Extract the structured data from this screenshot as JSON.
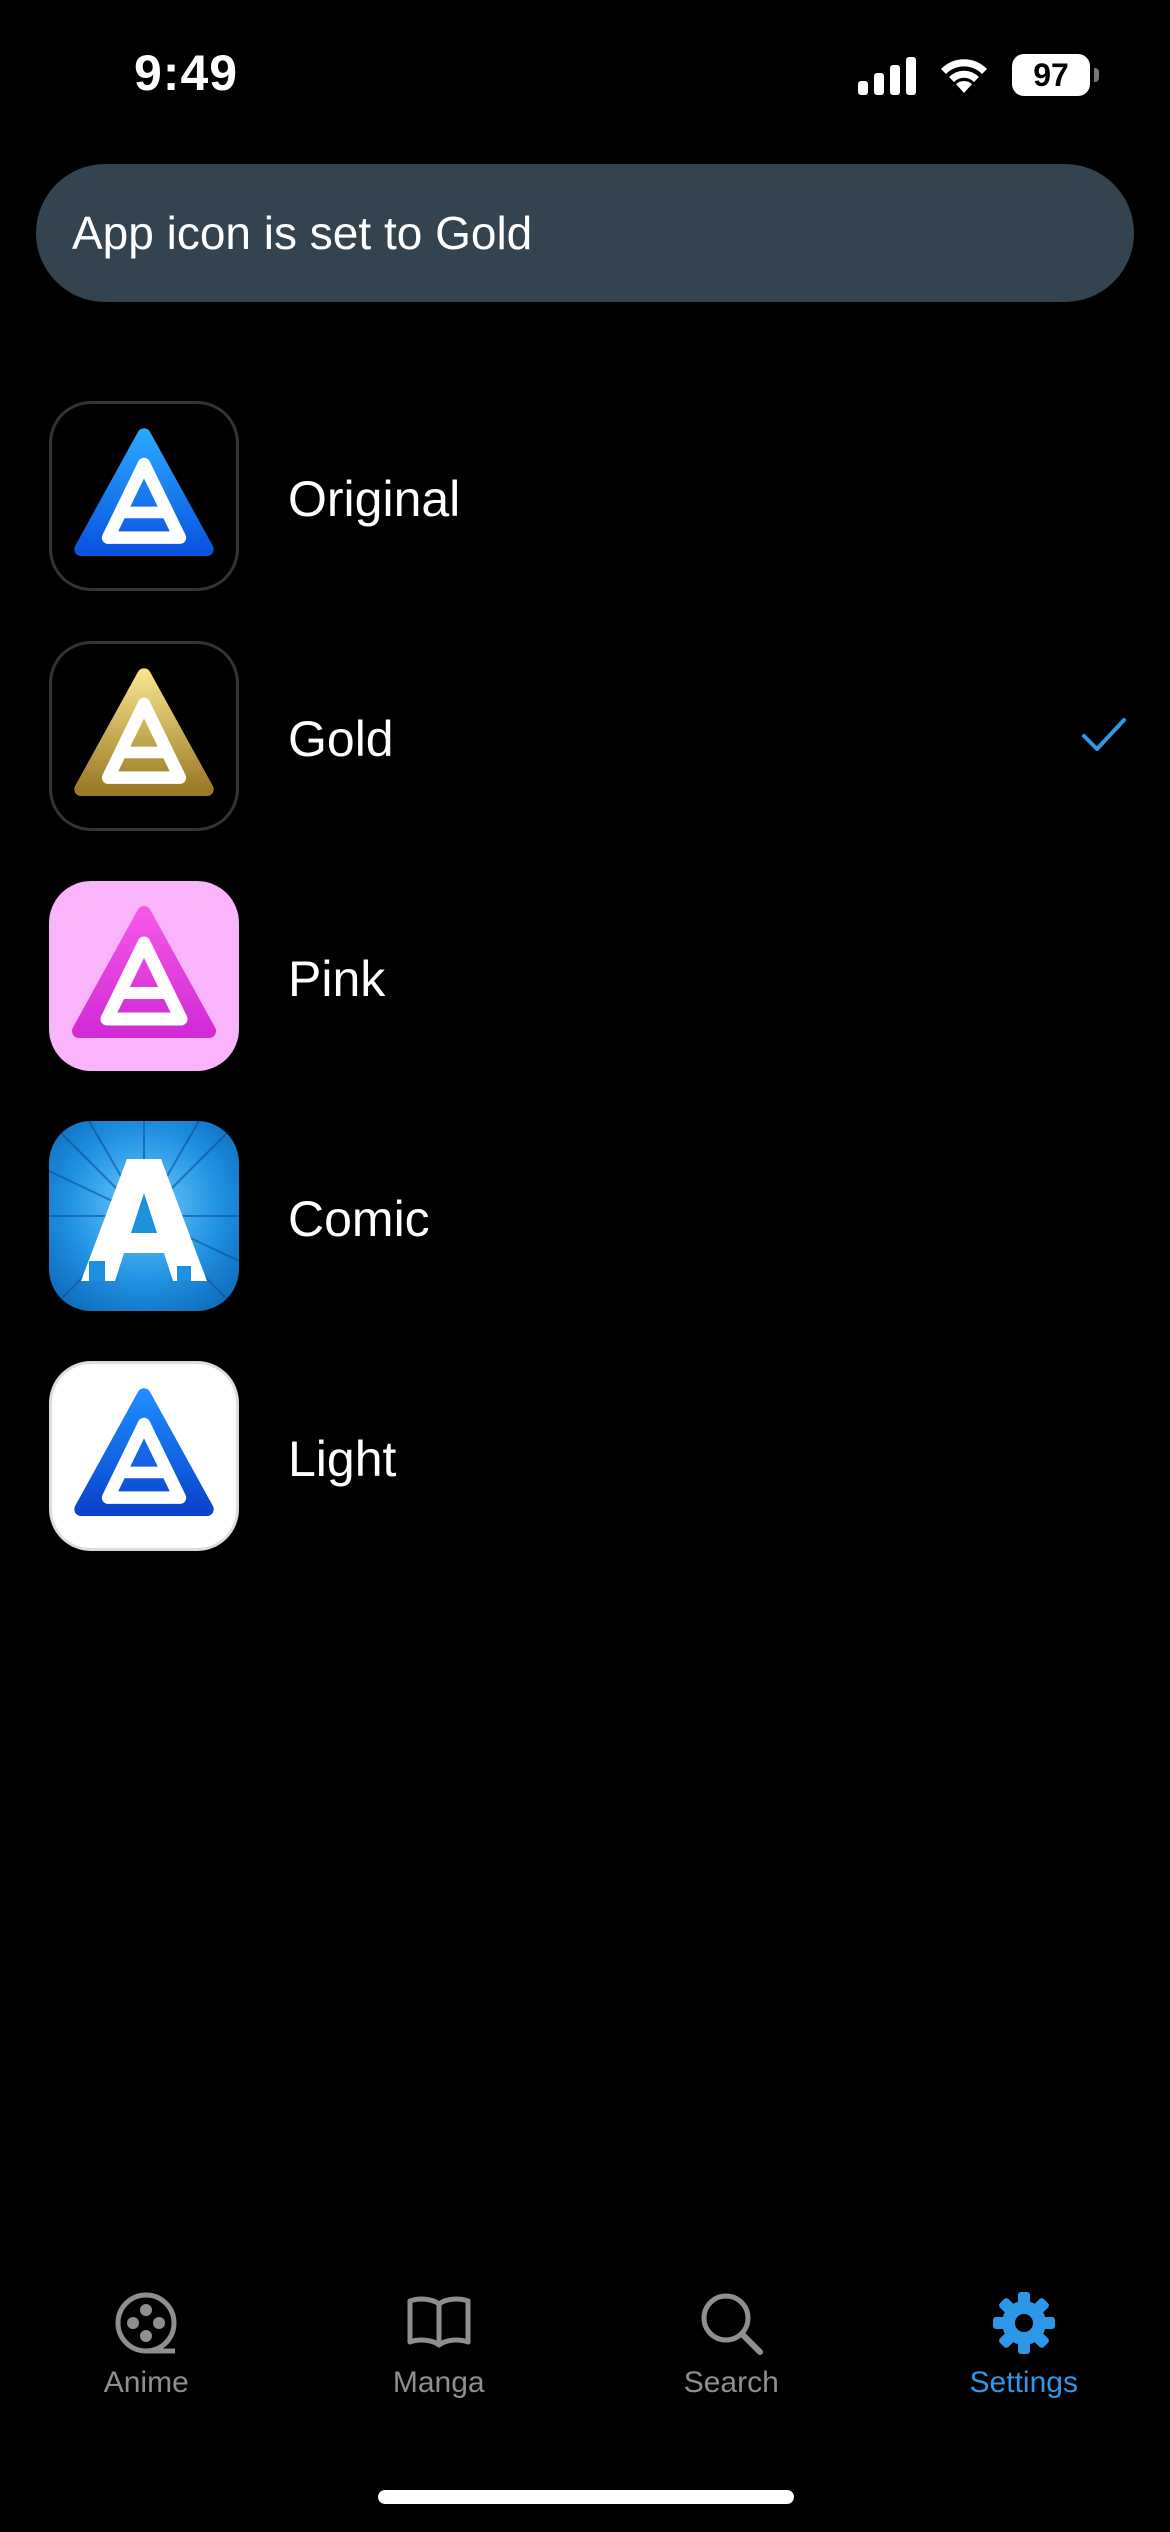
{
  "status_bar": {
    "time": "9:49",
    "battery": "97"
  },
  "toast": {
    "message": "App icon is set to Gold"
  },
  "icons": [
    {
      "label": "Original",
      "selected": false,
      "icon": "original-icon"
    },
    {
      "label": "Gold",
      "selected": true,
      "icon": "gold-icon"
    },
    {
      "label": "Pink",
      "selected": false,
      "icon": "pink-icon"
    },
    {
      "label": "Comic",
      "selected": false,
      "icon": "comic-icon"
    },
    {
      "label": "Light",
      "selected": false,
      "icon": "light-icon"
    }
  ],
  "tab_bar": {
    "tabs": [
      {
        "label": "Anime",
        "icon": "film-reel-icon",
        "active": false
      },
      {
        "label": "Manga",
        "icon": "book-icon",
        "active": false
      },
      {
        "label": "Search",
        "icon": "search-icon",
        "active": false
      },
      {
        "label": "Settings",
        "icon": "gear-icon",
        "active": true
      }
    ]
  },
  "colors": {
    "background": "#000000",
    "toast_bg": "#33434f",
    "accent": "#2e97e8",
    "tab_inactive": "#8e8e93"
  }
}
